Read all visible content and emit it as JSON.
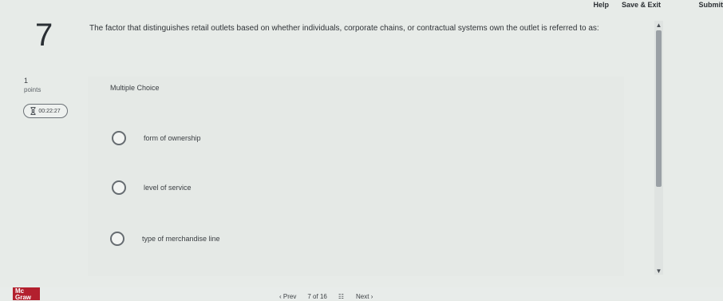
{
  "header": {
    "help": "Help",
    "save_exit": "Save & Exit",
    "submit": "Submit"
  },
  "question": {
    "number": "7",
    "points_value": "1",
    "points_label": "points",
    "timer": "00:22:27",
    "text": "The factor that distinguishes retail outlets based on whether individuals, corporate chains, or contractual systems own the outlet is referred to as:",
    "type": "Multiple Choice",
    "options": [
      {
        "label": "form of ownership"
      },
      {
        "label": "level of service"
      },
      {
        "label": "type of merchandise line"
      }
    ]
  },
  "footer": {
    "logo": "Mc Graw",
    "prev": "Prev",
    "page_current": "7",
    "page_of": "of",
    "page_total": "16",
    "next": "Next"
  }
}
